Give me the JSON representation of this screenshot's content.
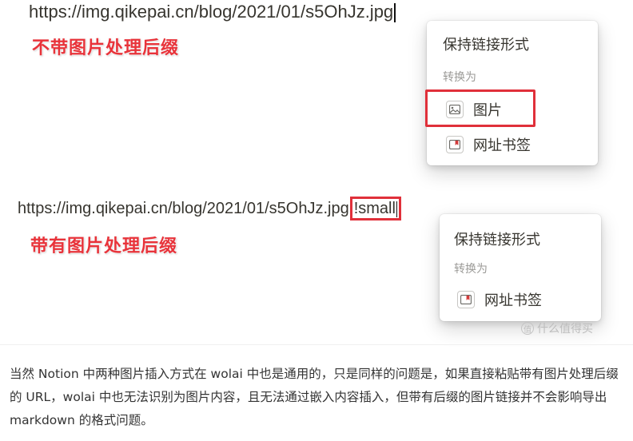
{
  "shot1": {
    "url": "https://img.qikepai.cn/blog/2021/01/s5OhJz.jpg",
    "label": "不带图片处理后缀",
    "menu": {
      "title": "保持链接形式",
      "subtitle": "转换为",
      "items": [
        {
          "icon": "image-icon",
          "label": "图片"
        },
        {
          "icon": "bookmark-icon",
          "label": "网址书签"
        }
      ]
    }
  },
  "shot2": {
    "url": "https://img.qikepai.cn/blog/2021/01/s5OhJz.jpg",
    "suffix": "!small",
    "label": "带有图片处理后缀",
    "menu": {
      "title": "保持链接形式",
      "subtitle": "转换为",
      "items": [
        {
          "icon": "bookmark-icon",
          "label": "网址书签"
        }
      ]
    }
  },
  "watermark": "什么值得买",
  "watermark_logo": "值",
  "article": {
    "paragraph": "当然 Notion 中两种图片插入方式在 wolai 中也是通用的，只是同样的问题是，如果直接粘贴带有图片处理后缀的 URL，wolai 中也无法识别为图片内容，且无法通过嵌入内容插入，但带有后缀的图片链接并不会影响导出 markdown 的格式问题。"
  },
  "colors": {
    "highlight_red": "#e0303a",
    "label_red": "#e8333a",
    "menu_text": "#37352f",
    "menu_subtext": "#9b9a97"
  }
}
